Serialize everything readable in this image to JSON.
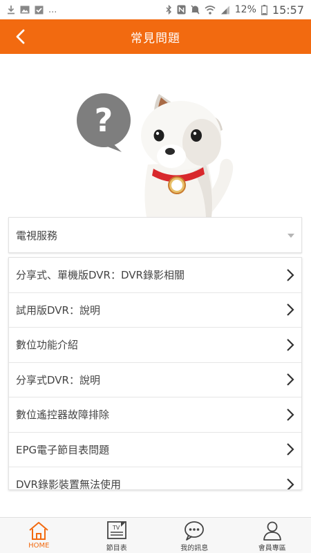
{
  "status_bar": {
    "more": "...",
    "battery": "12%",
    "time": "15:57"
  },
  "header": {
    "title": "常見問題",
    "accent_color": "#f26a10"
  },
  "hero": {
    "bubble_text": "?"
  },
  "category": {
    "selected": "電視服務"
  },
  "faq_items": [
    "分享式、單機版DVR：DVR錄影相關",
    "試用版DVR：說明",
    "數位功能介紹",
    "分享式DVR：說明",
    "數位遙控器故障排除",
    "EPG電子節目表問題",
    "DVR錄影裝置無法使用"
  ],
  "bottom_nav": {
    "items": [
      {
        "label": "HOME",
        "icon": "home-icon",
        "active": true
      },
      {
        "label": "節目表",
        "icon": "tv-guide-icon",
        "icon_text": "TV",
        "active": false
      },
      {
        "label": "我的訊息",
        "icon": "chat-bubble-icon",
        "active": false
      },
      {
        "label": "會員專區",
        "icon": "member-icon",
        "active": false
      }
    ]
  }
}
